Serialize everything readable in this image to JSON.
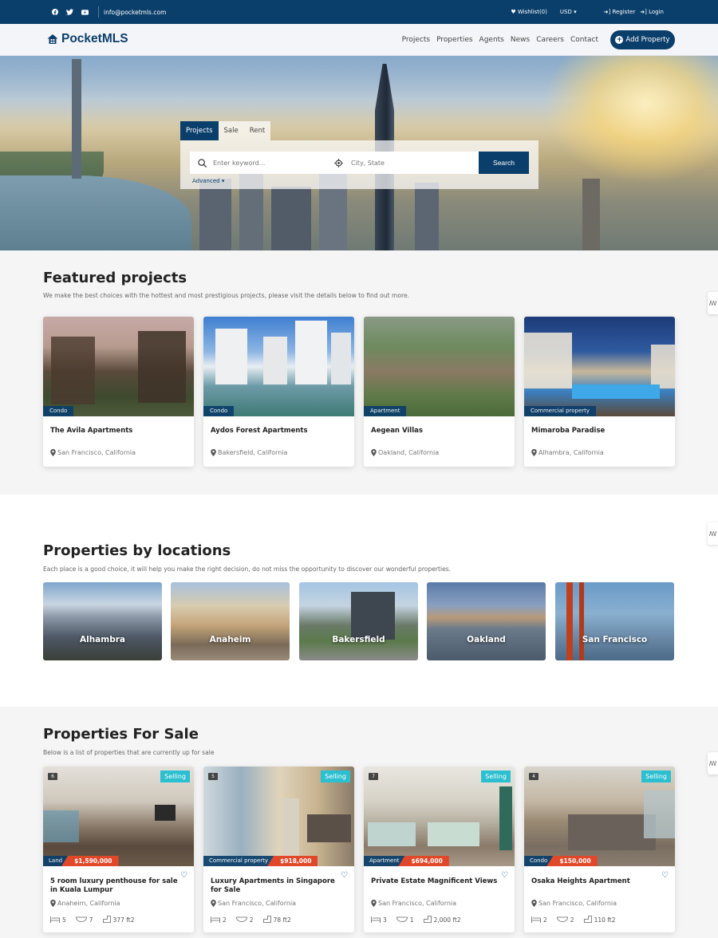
{
  "topbar": {
    "social_icons": [
      "facebook-icon",
      "twitter-icon",
      "youtube-icon"
    ],
    "email": "info@pocketmls.com",
    "wishlist": "Wishlist(0)",
    "currency": "USD",
    "register": "Register",
    "login": "Login"
  },
  "navbar": {
    "logo_text": "PocketMLS",
    "links": [
      "Projects",
      "Properties",
      "Agents",
      "News",
      "Careers",
      "Contact"
    ],
    "add_property": "Add Property"
  },
  "search": {
    "tabs": [
      "Projects",
      "Sale",
      "Rent"
    ],
    "active_tab": "Projects",
    "keyword_placeholder": "Enter keyword...",
    "location_placeholder": "City, State",
    "search_button": "Search",
    "advanced": "Advanced"
  },
  "featured": {
    "title": "Featured projects",
    "subtitle": "We make the best choices with the hottest and most prestigious projects, please visit the details below to find out more.",
    "items": [
      {
        "name": "The Avila Apartments",
        "type": "Condo",
        "location": "San Francisco, California"
      },
      {
        "name": "Aydos Forest Apartments",
        "type": "Condo",
        "location": "Bakersfield, California"
      },
      {
        "name": "Aegean Villas",
        "type": "Apartment",
        "location": "Oakland, California"
      },
      {
        "name": "Mimaroba Paradise",
        "type": "Commercial property",
        "location": "Alhambra, California"
      }
    ]
  },
  "locations": {
    "title": "Properties by locations",
    "subtitle": "Each place is a good choice, it will help you make the right decision, do not miss the opportunity to discover our wonderful properties.",
    "items": [
      "Alhambra",
      "Anaheim",
      "Bakersfield",
      "Oakland",
      "San Francisco"
    ]
  },
  "sale": {
    "title": "Properties For Sale",
    "subtitle": "Below is a list of properties that are currently up for sale",
    "status_label": "Selling",
    "items": [
      {
        "photos": "6",
        "type": "Land",
        "price": "$1,590,000",
        "title": "5 room luxury penthouse for sale in Kuala Lumpur",
        "location": "Anaheim, California",
        "beds": "5",
        "baths": "7",
        "area": "377 ft2"
      },
      {
        "photos": "5",
        "type": "Commercial property",
        "price": "$918,000",
        "title": "Luxury Apartments in Singapore for Sale",
        "location": "San Francisco, California",
        "beds": "2",
        "baths": "2",
        "area": "78 ft2"
      },
      {
        "photos": "7",
        "type": "Apartment",
        "price": "$694,000",
        "title": "Private Estate Magnificent Views",
        "location": "San Francisco, California",
        "beds": "3",
        "baths": "1",
        "area": "2,000 ft2"
      },
      {
        "photos": "4",
        "type": "Condo",
        "price": "$150,000",
        "title": "Osaka Heights Apartment",
        "location": "San Francisco, California",
        "beds": "2",
        "baths": "2",
        "area": "110 ft2"
      }
    ]
  },
  "colors": {
    "brand": "#0b3f6b",
    "price": "#e1482a",
    "selling": "#2bbfd0"
  }
}
